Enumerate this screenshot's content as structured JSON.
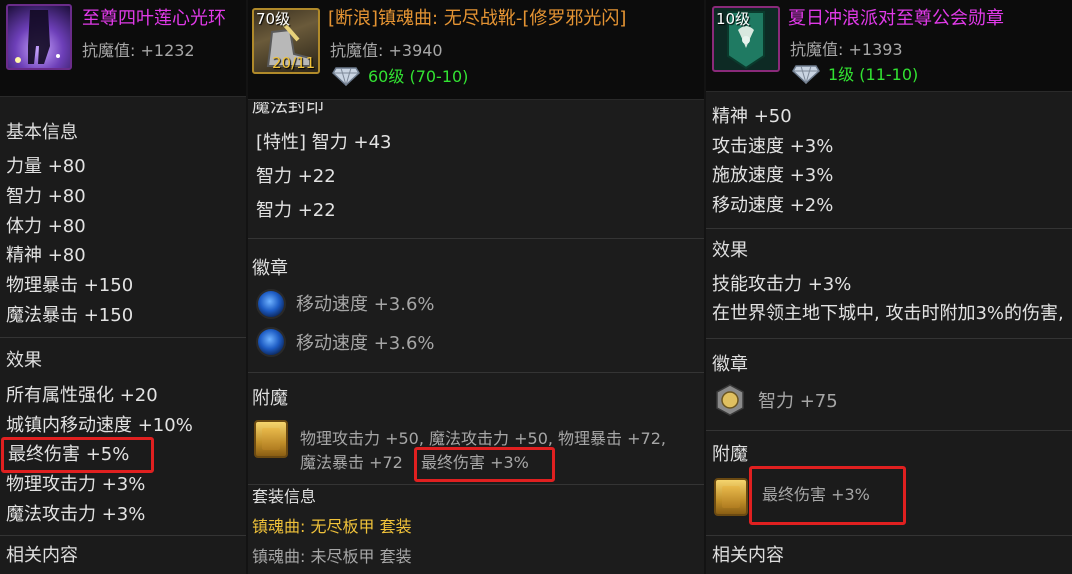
{
  "panel1": {
    "title": "至尊四叶莲心光环",
    "resist": "抗魔值: +1232",
    "basic_header": "基本信息",
    "stats": [
      "力量 +80",
      "智力 +80",
      "体力 +80",
      "精神 +80",
      "物理暴击 +150",
      "魔法暴击 +150"
    ],
    "effect_header": "效果",
    "effects": [
      "所有属性强化 +20",
      "城镇内移动速度 +10%",
      "最终伤害 +5%",
      "物理攻击力 +3%",
      "魔法攻击力 +3%"
    ],
    "related_header": "相关内容"
  },
  "panel2": {
    "level_badge": "70级",
    "count_badge": "20/11",
    "title": "[断浪]镇魂曲: 无尽战靴-[修罗邪光闪]",
    "resist": "抗魔值: +3940",
    "gem_text": "60级 (70-10)",
    "seal_header": "魔法封印",
    "seal_lines": [
      "[特性] 智力 +43",
      "智力 +22",
      "智力 +22"
    ],
    "emblem_header": "徽章",
    "emblems": [
      "移动速度 +3.6%",
      "移动速度 +3.6%"
    ],
    "enchant_header": "附魔",
    "enchant_line1": "物理攻击力 +50, 魔法攻击力 +50, 物理暴击 +72,",
    "enchant_line2_a": "魔法暴击 +72",
    "enchant_line2_b": "最终伤害 +3%",
    "set_header": "套装信息",
    "set_active": "镇魂曲: 无尽板甲 套装",
    "set_inactive": "镇魂曲: 未尽板甲 套装"
  },
  "panel3": {
    "level_badge": "10级",
    "title": "夏日冲浪派对至尊公会勋章",
    "resist": "抗魔值: +1393",
    "gem_text": "1级 (11-10)",
    "stats": [
      "精神 +50",
      "攻击速度 +3%",
      "施放速度 +3%",
      "移动速度 +2%"
    ],
    "effect_header": "效果",
    "effects": [
      "技能攻击力 +3%",
      "在世界领主地下城中, 攻击时附加3%的伤害,"
    ],
    "emblem_header": "徽章",
    "emblem": "智力 +75",
    "enchant_header": "附魔",
    "enchant": "最终伤害 +3%",
    "related_header": "相关内容"
  },
  "colors": {
    "title_purple": "#e03ae8",
    "title_orange": "#e59433",
    "set_yellow": "#f0c23a",
    "gem_green": "#32e232",
    "highlight_red": "#e02020"
  }
}
